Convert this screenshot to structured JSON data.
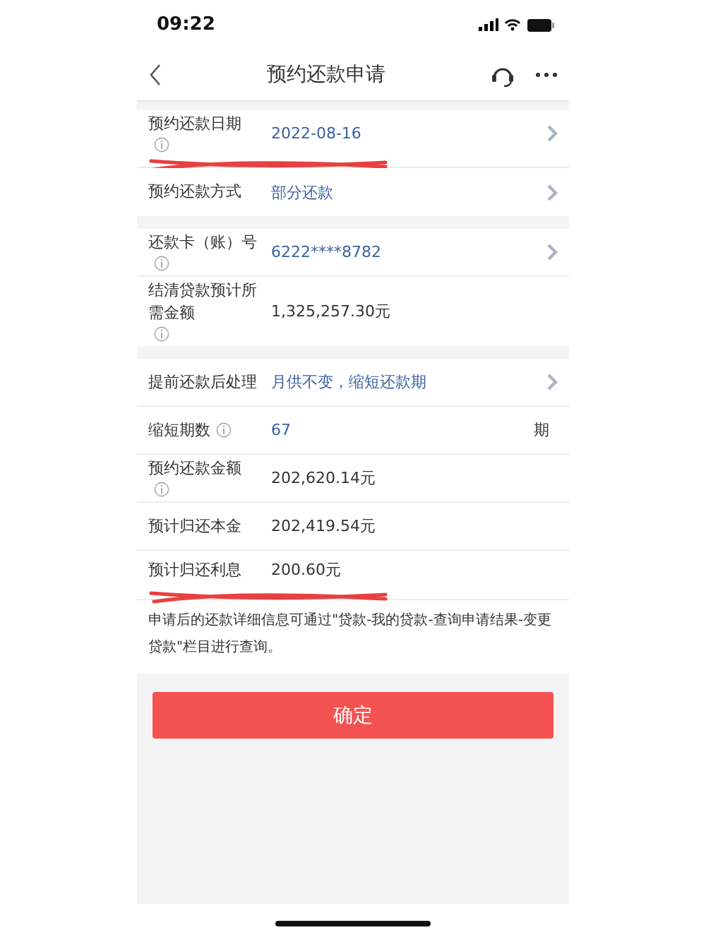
{
  "status_bar": {
    "time": "09:22"
  },
  "nav": {
    "title": "预约还款申请"
  },
  "sections": [
    {
      "rows": [
        {
          "label": "预约还款日期",
          "info": true,
          "value": "2022-08-16",
          "kind": "link",
          "chevron": true,
          "underlined": true
        },
        {
          "label": "预约还款方式",
          "info": false,
          "value": "部分还款",
          "kind": "link",
          "chevron": true,
          "underlined": false
        }
      ]
    },
    {
      "rows": [
        {
          "label": "还款卡（账）号",
          "info": true,
          "value": "6222****8782",
          "kind": "link",
          "chevron": true,
          "underlined": false
        },
        {
          "label": "结清贷款预计所需金额",
          "info": true,
          "value": "1,325,257.30元",
          "kind": "plain",
          "chevron": false,
          "underlined": false
        }
      ]
    },
    {
      "rows": [
        {
          "label": "提前还款后处理",
          "info": false,
          "value": "月供不变，缩短还款期",
          "kind": "link",
          "chevron": true,
          "underlined": false
        },
        {
          "label": "缩短期数",
          "info": true,
          "value": "67",
          "kind": "link",
          "chevron": false,
          "unit": "期",
          "underlined": false
        },
        {
          "label": "预约还款金额",
          "info": true,
          "value": "202,620.14元",
          "kind": "plain",
          "chevron": false,
          "underlined": false
        },
        {
          "label": "预计归还本金",
          "info": false,
          "value": "202,419.54元",
          "kind": "plain",
          "chevron": false,
          "underlined": false
        },
        {
          "label": "预计归还利息",
          "info": false,
          "value": "200.60元",
          "kind": "plain",
          "chevron": false,
          "underlined": true
        }
      ]
    }
  ],
  "note": "申请后的还款详细信息可通过\"贷款-我的贷款-查询申请结果-变更贷款\"栏目进行查询。",
  "confirm_button": "确定"
}
